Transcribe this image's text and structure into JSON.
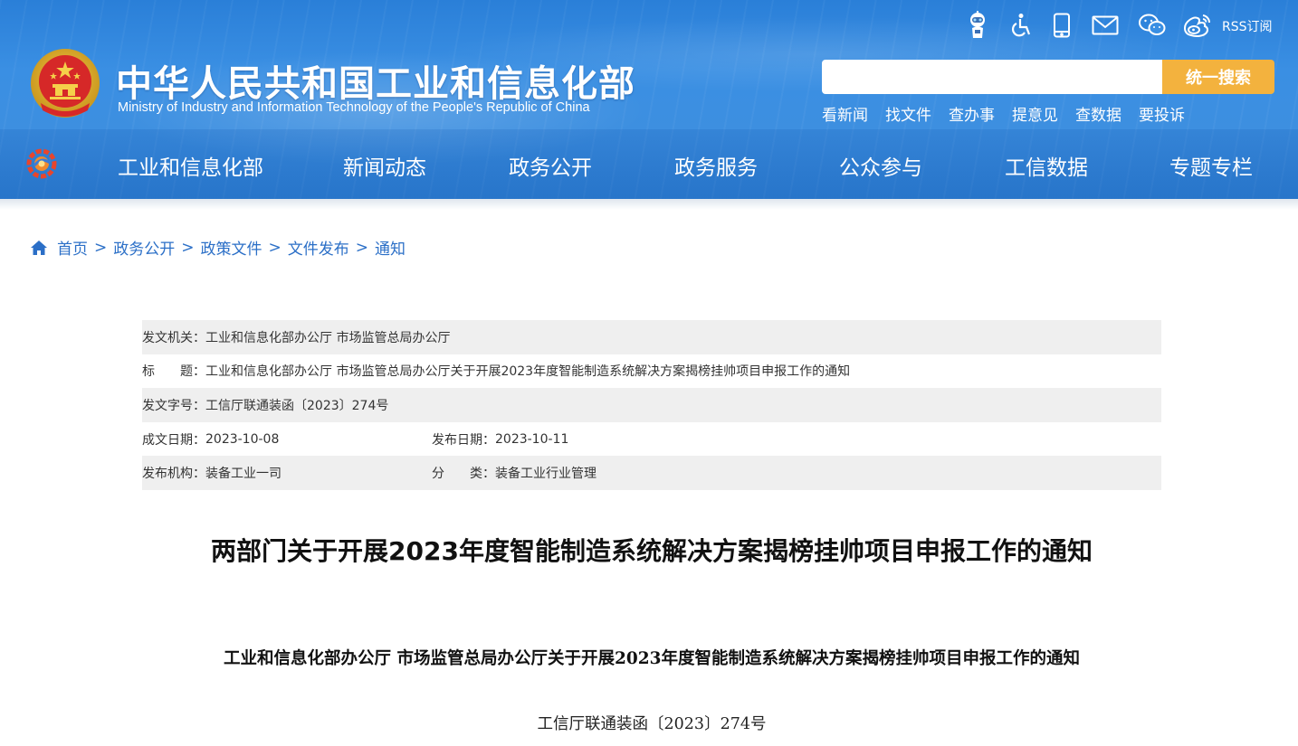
{
  "header": {
    "title_cn": "中华人民共和国工业和信息化部",
    "title_en": "Ministry of Industry and Information Technology of the People's Republic of China",
    "utility_icons": [
      "assistant-robot-icon",
      "accessibility-icon",
      "mobile-icon",
      "mail-icon",
      "wechat-icon",
      "weibo-icon"
    ],
    "rss_label": "RSS订阅",
    "search": {
      "placeholder": "",
      "value": "",
      "button_label": "统一搜索"
    },
    "quick_links": [
      "看新闻",
      "找文件",
      "查办事",
      "提意见",
      "查数据",
      "要投诉"
    ],
    "nav": [
      "工业和信息化部",
      "新闻动态",
      "政务公开",
      "政务服务",
      "公众参与",
      "工信数据",
      "专题专栏"
    ]
  },
  "breadcrumb": [
    "首页",
    "政务公开",
    "政策文件",
    "文件发布",
    "通知"
  ],
  "breadcrumb_separator": ">",
  "meta": {
    "issuer_label": "发文机关：",
    "issuer": "工业和信息化部办公厅 市场监管总局办公厅",
    "title_label": "标　　题：",
    "title": "工业和信息化部办公厅 市场监管总局办公厅关于开展2023年度智能制造系统解决方案揭榜挂帅项目申报工作的通知",
    "doc_no_label": "发文字号：",
    "doc_no": "工信厅联通装函〔2023〕274号",
    "created_label": "成文日期：",
    "created": "2023-10-08",
    "published_label": "发布日期：",
    "published": "2023-10-11",
    "org_label": "发布机构：",
    "org": "装备工业一司",
    "category_label": "分　　类：",
    "category": "装备工业行业管理"
  },
  "article": {
    "title": "两部门关于开展2023年度智能制造系统解决方案揭榜挂帅项目申报工作的通知",
    "heading": "工业和信息化部办公厅  市场监管总局办公厅关于开展2023年度智能制造系统解决方案揭榜挂帅项目申报工作的通知",
    "doc_number": "工信厅联通装函〔2023〕274号"
  },
  "colors": {
    "header_blue": "#3a8fe3",
    "search_button": "#f3b23e",
    "breadcrumb_link": "#2b6fc7",
    "meta_shade": "#efefef"
  }
}
